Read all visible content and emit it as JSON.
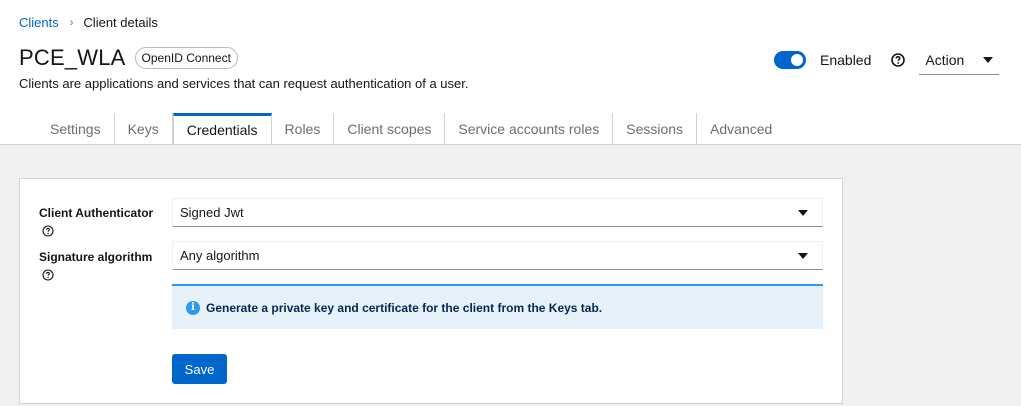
{
  "breadcrumb": {
    "parent": "Clients",
    "separator": "›",
    "current": "Client details"
  },
  "header": {
    "title": "PCE_WLA",
    "badge": "OpenID Connect",
    "subtitle": "Clients are applications and services that can request authentication of a user.",
    "enabled_label": "Enabled",
    "enabled": true,
    "action_label": "Action"
  },
  "tabs": [
    {
      "label": "Settings",
      "active": false
    },
    {
      "label": "Keys",
      "active": false
    },
    {
      "label": "Credentials",
      "active": true
    },
    {
      "label": "Roles",
      "active": false
    },
    {
      "label": "Client scopes",
      "active": false
    },
    {
      "label": "Service accounts roles",
      "active": false
    },
    {
      "label": "Sessions",
      "active": false
    },
    {
      "label": "Advanced",
      "active": false
    }
  ],
  "form": {
    "client_authenticator": {
      "label": "Client Authenticator",
      "value": "Signed Jwt"
    },
    "signature_algorithm": {
      "label": "Signature algorithm",
      "value": "Any algorithm"
    },
    "alert_text": "Generate a private key and certificate for the client from the Keys tab.",
    "save_label": "Save"
  },
  "colors": {
    "accent": "#0066cc",
    "info": "#2b9af3",
    "info_bg": "#e7f1fa"
  }
}
